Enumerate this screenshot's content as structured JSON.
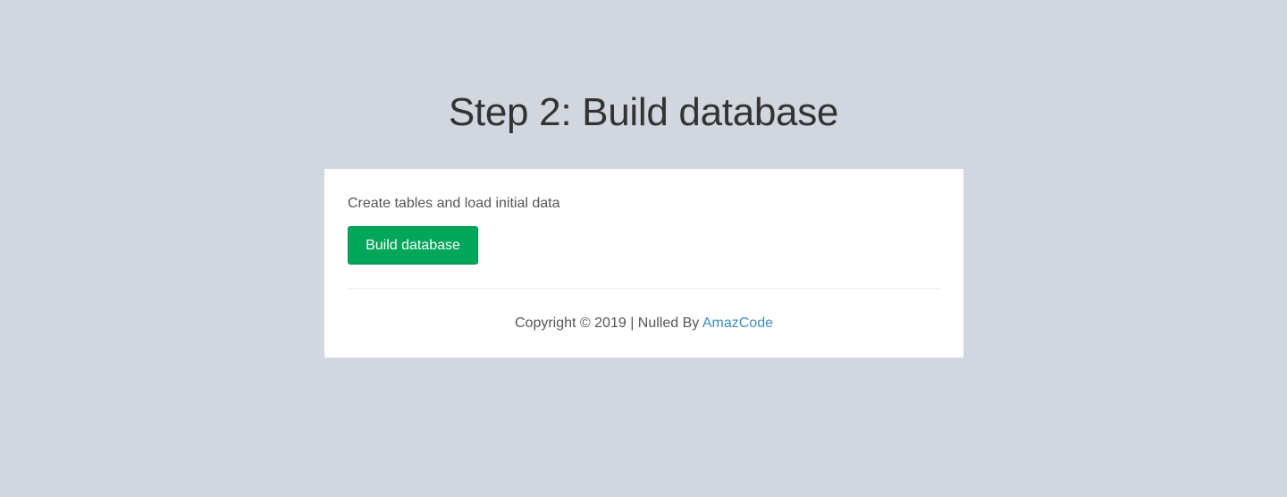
{
  "page": {
    "title": "Step 2: Build database"
  },
  "card": {
    "description": "Create tables and load initial data",
    "button_label": "Build database"
  },
  "footer": {
    "copyright_text": "Copyright © 2019 | Nulled By ",
    "link_text": "AmazCode"
  },
  "colors": {
    "background": "#d2d6de",
    "card_background": "#ffffff",
    "button_green": "#00a65a",
    "link_blue": "#3c8dbc"
  }
}
